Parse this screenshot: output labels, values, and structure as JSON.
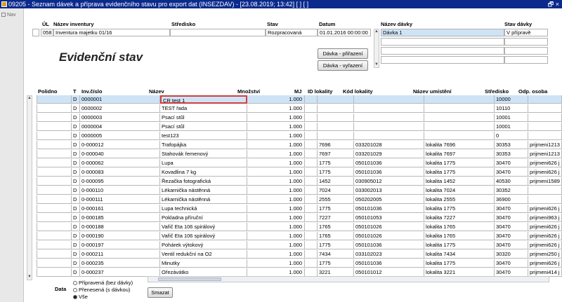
{
  "window": {
    "title": "09205 - Seznam dávek a příprava evidenčního stavu pro export dat (INSEZDAV) - [23.08.2019; 13:42] [ ] [ ]",
    "controls": "🗗 ×"
  },
  "nav": {
    "label": "Nav"
  },
  "inventory_form": {
    "headers": {
      "ul": "ÚL",
      "name": "Název inventury",
      "center": "Středisko",
      "state": "Stav",
      "date": "Datum"
    },
    "ul": "058",
    "name": "Inventura majetku 01/16",
    "center": "",
    "state": "Rozpracovaná",
    "date": "01.01.2016 00:00:00"
  },
  "batch_panel": {
    "headers": {
      "name": "Název dávky",
      "state": "Stav dávky"
    },
    "rows": [
      {
        "name": "Dávka 1",
        "state": "V přípravě"
      },
      {
        "name": "",
        "state": ""
      },
      {
        "name": "",
        "state": ""
      },
      {
        "name": "",
        "state": ""
      }
    ]
  },
  "section_title": "Evidenční stav",
  "buttons": {
    "assign": "Dávka - přiřazení",
    "remove": "Dávka - vyřazení",
    "delete": "Smazat"
  },
  "grid": {
    "headers": {
      "polidno": "Polidno",
      "t": "T",
      "inv": "Inv.číslo",
      "name": "Název",
      "qty": "Množství",
      "mj": "MJ",
      "id_loc": "ID lokality",
      "loc_code": "Kód lokality",
      "loc_name": "Název umístění",
      "center": "Středisko",
      "person": "Odp. osoba"
    },
    "rows": [
      {
        "t": "D",
        "inv": "0000001",
        "name": "CR test 1",
        "qty": "1.000",
        "id": "",
        "code": "",
        "loc": "",
        "center": "10000",
        "person": ""
      },
      {
        "t": "D",
        "inv": "0000002",
        "name": "TEST řada",
        "qty": "1.000",
        "id": "",
        "code": "",
        "loc": "",
        "center": "10110",
        "person": ""
      },
      {
        "t": "D",
        "inv": "0000003",
        "name": "Psací stůl",
        "qty": "1.000",
        "id": "",
        "code": "",
        "loc": "",
        "center": "10001",
        "person": ""
      },
      {
        "t": "D",
        "inv": "0000004",
        "name": "Psací stůl",
        "qty": "1.000",
        "id": "",
        "code": "",
        "loc": "",
        "center": "10001",
        "person": ""
      },
      {
        "t": "D",
        "inv": "0000005",
        "name": "test123",
        "qty": "1.000",
        "id": "",
        "code": "",
        "loc": "",
        "center": "0",
        "person": ""
      },
      {
        "t": "D",
        "inv": "0-000012",
        "name": "Trafopájka",
        "qty": "1.000",
        "id": "7696",
        "code": "033201028",
        "loc": "lokalita 7696",
        "center": "30353",
        "person": "prijmeni1213"
      },
      {
        "t": "D",
        "inv": "0-000040",
        "name": "Stahovák řemenový",
        "qty": "1.000",
        "id": "7697",
        "code": "033201029",
        "loc": "lokalita 7697",
        "center": "30353",
        "person": "prijmeni1213"
      },
      {
        "t": "D",
        "inv": "0-000062",
        "name": "Lupa",
        "qty": "1.000",
        "id": "1775",
        "code": "050101036",
        "loc": "lokalita 1775",
        "center": "30470",
        "person": "prijmeni626 j"
      },
      {
        "t": "D",
        "inv": "0-000083",
        "name": "Kovadlina 7 kg",
        "qty": "1.000",
        "id": "1775",
        "code": "050101036",
        "loc": "lokalita 1775",
        "center": "30470",
        "person": "prijmeni626 j"
      },
      {
        "t": "D",
        "inv": "0-000095",
        "name": "Řezačka fotografická",
        "qty": "1.000",
        "id": "1452",
        "code": "030905012",
        "loc": "lokalita 1452",
        "center": "40530",
        "person": "prijmeni1589"
      },
      {
        "t": "D",
        "inv": "0-000110",
        "name": "Lékarnička nástěnná",
        "qty": "1.000",
        "id": "7024",
        "code": "033002013",
        "loc": "lokalita 7024",
        "center": "30352",
        "person": ""
      },
      {
        "t": "D",
        "inv": "0-000111",
        "name": "Lékarnička nástěnná",
        "qty": "1.000",
        "id": "2555",
        "code": "050202005",
        "loc": "lokalita 2555",
        "center": "36900",
        "person": ""
      },
      {
        "t": "D",
        "inv": "0-000161",
        "name": "Lupa technická",
        "qty": "1.000",
        "id": "1775",
        "code": "050101036",
        "loc": "lokalita 1775",
        "center": "30470",
        "person": "prijmeni626 j"
      },
      {
        "t": "D",
        "inv": "0-000185",
        "name": "Pokladna příruční",
        "qty": "1.000",
        "id": "7227",
        "code": "050101053",
        "loc": "lokalita 7227",
        "center": "30470",
        "person": "prijmeni963 j"
      },
      {
        "t": "D",
        "inv": "0-000188",
        "name": "Vařič Eta 106 spirálový",
        "qty": "1.000",
        "id": "1765",
        "code": "050101026",
        "loc": "lokalita 1765",
        "center": "30470",
        "person": "prijmeni626 j"
      },
      {
        "t": "D",
        "inv": "0-000190",
        "name": "Vařič Eta 106 spirálový",
        "qty": "1.000",
        "id": "1765",
        "code": "050101026",
        "loc": "lokalita 1765",
        "center": "30470",
        "person": "prijmeni626 j"
      },
      {
        "t": "D",
        "inv": "0-000197",
        "name": "Pohárek výtokový",
        "qty": "1.000",
        "id": "1775",
        "code": "050101036",
        "loc": "lokalita 1775",
        "center": "30470",
        "person": "prijmeni626 j"
      },
      {
        "t": "D",
        "inv": "0-000211",
        "name": "Ventil redukční na O2",
        "qty": "1.000",
        "id": "7434",
        "code": "033102023",
        "loc": "lokalita 7434",
        "center": "30320",
        "person": "prijmeni250 j"
      },
      {
        "t": "D",
        "inv": "0-000235",
        "name": "Minutky",
        "qty": "1.000",
        "id": "1775",
        "code": "050101036",
        "loc": "lokalita 1775",
        "center": "30470",
        "person": "prijmeni626 j"
      },
      {
        "t": "D",
        "inv": "0-000237",
        "name": "Ořezávátko",
        "qty": "1.000",
        "id": "3221",
        "code": "050101012",
        "loc": "lokalita 3221",
        "center": "30470",
        "person": "prijmeni414 j"
      }
    ]
  },
  "filter": {
    "label": "Data",
    "options": [
      "Připravená (bez dávky)",
      "Přenesená (s dávkou)",
      "Vše"
    ],
    "selected_index": 2
  }
}
